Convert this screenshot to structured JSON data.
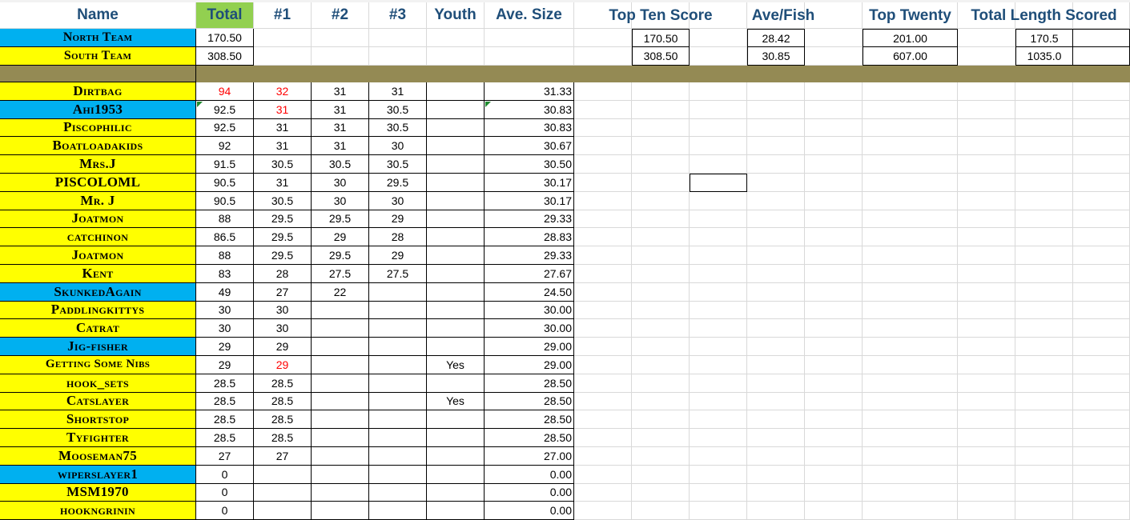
{
  "headers": {
    "name": "Name",
    "total": "Total",
    "c1": "#1",
    "c2": "#2",
    "c3": "#3",
    "youth": "Youth",
    "ave_size": "Ave. Size",
    "top_ten_score": "Top Ten Score",
    "ave_fish": "Ave/Fish",
    "top_twenty": "Top Twenty",
    "total_length_scored": "Total Length Scored"
  },
  "teams": [
    {
      "name": "North Team",
      "total": "170.50",
      "top_ten_score": "170.50",
      "ave_fish": "28.42",
      "top_twenty": "201.00",
      "total_length": "170.5",
      "color": "#00b0f0"
    },
    {
      "name": "South Team",
      "total": "308.50",
      "top_ten_score": "308.50",
      "ave_fish": "30.85",
      "top_twenty": "607.00",
      "total_length": "1035.0",
      "color": "#ffff00"
    }
  ],
  "colors": {
    "north": "#00b0f0",
    "south": "#ffff00",
    "total_header": "#92d050",
    "separator": "#948a54",
    "header_text": "#1f4e79",
    "red_value": "#ff0000"
  },
  "players": [
    {
      "name": "Dirtbag",
      "team": "south",
      "total": "94",
      "c1": "32",
      "c2": "31",
      "c3": "31",
      "youth": "",
      "ave": "31.33",
      "red": [
        "total",
        "c1"
      ]
    },
    {
      "name": "Ahi1953",
      "team": "north",
      "total": "92.5",
      "c1": "31",
      "c2": "31",
      "c3": "30.5",
      "youth": "",
      "ave": "30.83",
      "red": [
        "c1"
      ]
    },
    {
      "name": "Piscophilic",
      "team": "south",
      "total": "92.5",
      "c1": "31",
      "c2": "31",
      "c3": "30.5",
      "youth": "",
      "ave": "30.83",
      "red": []
    },
    {
      "name": "Boatloadakids",
      "team": "south",
      "total": "92",
      "c1": "31",
      "c2": "31",
      "c3": "30",
      "youth": "",
      "ave": "30.67",
      "red": []
    },
    {
      "name": "Mrs.J",
      "team": "south",
      "total": "91.5",
      "c1": "30.5",
      "c2": "30.5",
      "c3": "30.5",
      "youth": "",
      "ave": "30.50",
      "red": []
    },
    {
      "name": "PISCOLOML",
      "team": "south",
      "total": "90.5",
      "c1": "31",
      "c2": "30",
      "c3": "29.5",
      "youth": "",
      "ave": "30.17",
      "red": []
    },
    {
      "name": "Mr. J",
      "team": "south",
      "total": "90.5",
      "c1": "30.5",
      "c2": "30",
      "c3": "30",
      "youth": "",
      "ave": "30.17",
      "red": []
    },
    {
      "name": "Joatmon",
      "team": "south",
      "total": "88",
      "c1": "29.5",
      "c2": "29.5",
      "c3": "29",
      "youth": "",
      "ave": "29.33",
      "red": []
    },
    {
      "name": "catchinon",
      "team": "south",
      "total": "86.5",
      "c1": "29.5",
      "c2": "29",
      "c3": "28",
      "youth": "",
      "ave": "28.83",
      "red": []
    },
    {
      "name": "Joatmon",
      "team": "south",
      "total": "88",
      "c1": "29.5",
      "c2": "29.5",
      "c3": "29",
      "youth": "",
      "ave": "29.33",
      "red": []
    },
    {
      "name": "Kent",
      "team": "south",
      "total": "83",
      "c1": "28",
      "c2": "27.5",
      "c3": "27.5",
      "youth": "",
      "ave": "27.67",
      "red": []
    },
    {
      "name": "SkunkedAgain",
      "team": "north",
      "total": "49",
      "c1": "27",
      "c2": "22",
      "c3": "",
      "youth": "",
      "ave": "24.50",
      "red": []
    },
    {
      "name": "Paddlingkittys",
      "team": "south",
      "total": "30",
      "c1": "30",
      "c2": "",
      "c3": "",
      "youth": "",
      "ave": "30.00",
      "red": []
    },
    {
      "name": "Catrat",
      "team": "south",
      "total": "30",
      "c1": "30",
      "c2": "",
      "c3": "",
      "youth": "",
      "ave": "30.00",
      "red": []
    },
    {
      "name": "Jig-fisher",
      "team": "north",
      "total": "29",
      "c1": "29",
      "c2": "",
      "c3": "",
      "youth": "",
      "ave": "29.00",
      "red": []
    },
    {
      "name": "Getting Some Nibs",
      "team": "south",
      "total": "29",
      "c1": "29",
      "c2": "",
      "c3": "",
      "youth": "Yes",
      "ave": "29.00",
      "red": [
        "c1"
      ]
    },
    {
      "name": "hook_sets",
      "team": "south",
      "total": "28.5",
      "c1": "28.5",
      "c2": "",
      "c3": "",
      "youth": "",
      "ave": "28.50",
      "red": []
    },
    {
      "name": "Catslayer",
      "team": "south",
      "total": "28.5",
      "c1": "28.5",
      "c2": "",
      "c3": "",
      "youth": "Yes",
      "ave": "28.50",
      "red": []
    },
    {
      "name": "Shortstop",
      "team": "south",
      "total": "28.5",
      "c1": "28.5",
      "c2": "",
      "c3": "",
      "youth": "",
      "ave": "28.50",
      "red": []
    },
    {
      "name": "Tyfighter",
      "team": "south",
      "total": "28.5",
      "c1": "28.5",
      "c2": "",
      "c3": "",
      "youth": "",
      "ave": "28.50",
      "red": []
    },
    {
      "name": "Mooseman75",
      "team": "south",
      "total": "27",
      "c1": "27",
      "c2": "",
      "c3": "",
      "youth": "",
      "ave": "27.00",
      "red": []
    },
    {
      "name": "wiperslayer1",
      "team": "north",
      "total": "0",
      "c1": "",
      "c2": "",
      "c3": "",
      "youth": "",
      "ave": "0.00",
      "red": []
    },
    {
      "name": "MSM1970",
      "team": "south",
      "total": "0",
      "c1": "",
      "c2": "",
      "c3": "",
      "youth": "",
      "ave": "0.00",
      "red": []
    },
    {
      "name": "hookngrinin",
      "team": "south",
      "total": "0",
      "c1": "",
      "c2": "",
      "c3": "",
      "youth": "",
      "ave": "0.00",
      "red": []
    }
  ]
}
